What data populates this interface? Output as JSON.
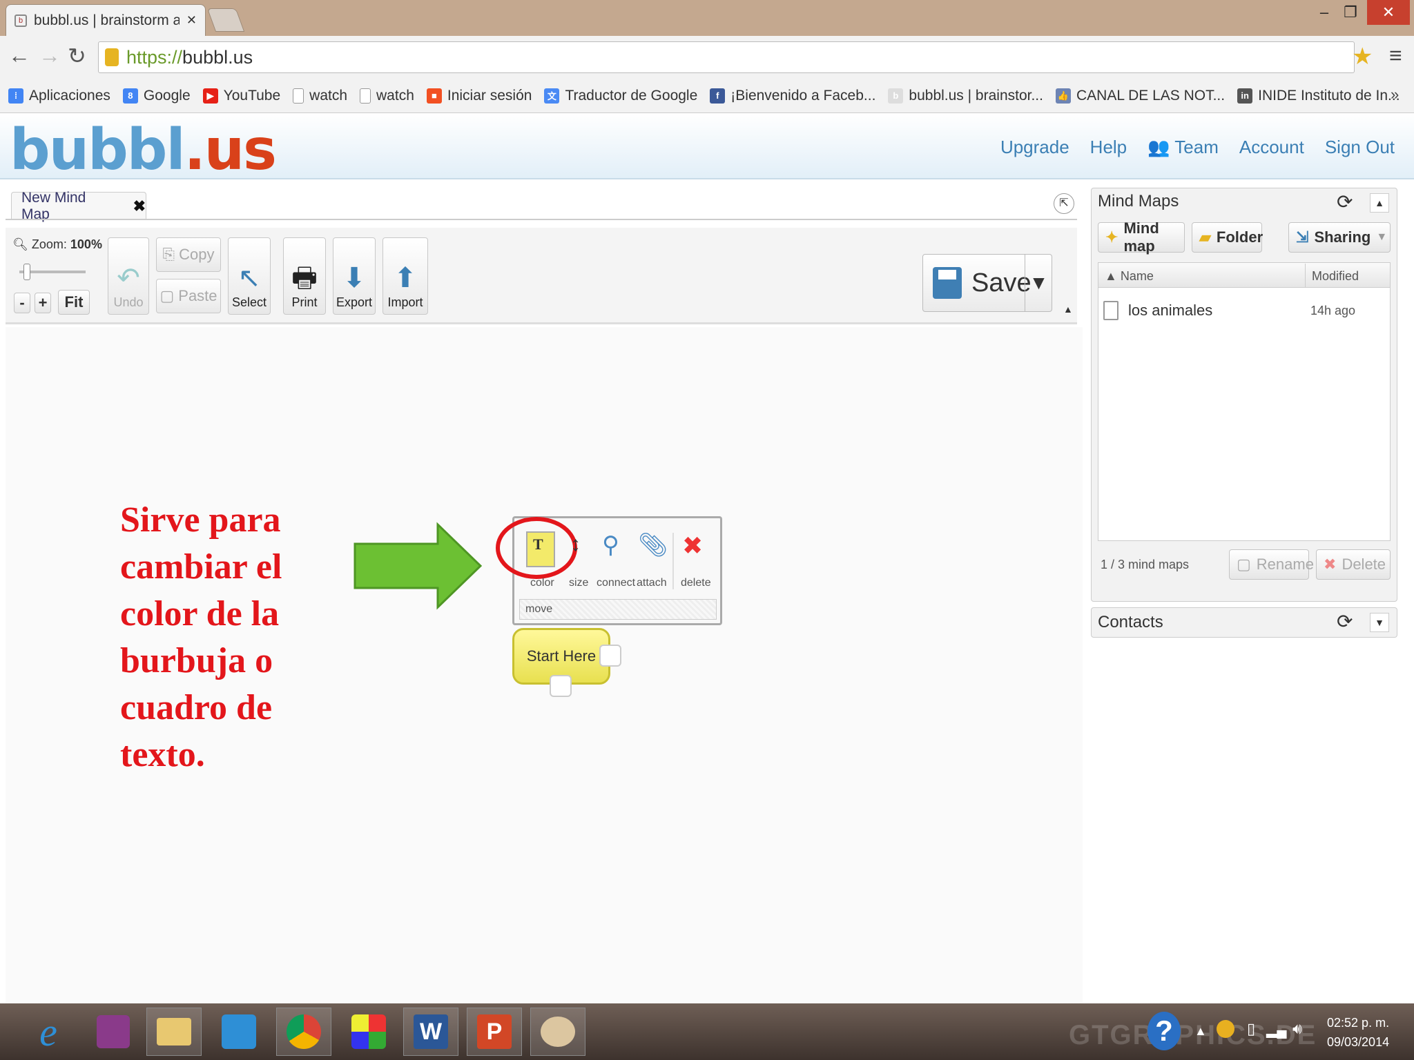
{
  "browser": {
    "tab_title": "bubbl.us | brainstorm and",
    "url_scheme": "https://",
    "url_host": "bubbl.us",
    "window_controls": {
      "minimize": "–",
      "restore": "❐",
      "close": "✕"
    },
    "bookmarks": [
      {
        "label": "Aplicaciones",
        "icon": "apps-icon"
      },
      {
        "label": "Google",
        "icon": "google-icon"
      },
      {
        "label": "YouTube",
        "icon": "youtube-icon"
      },
      {
        "label": "watch",
        "icon": "page-icon"
      },
      {
        "label": "watch",
        "icon": "page-icon"
      },
      {
        "label": "Iniciar sesión",
        "icon": "microsoft-icon"
      },
      {
        "label": "Traductor de Google",
        "icon": "translate-icon"
      },
      {
        "label": "¡Bienvenido a Faceb...",
        "icon": "facebook-icon"
      },
      {
        "label": "bubbl.us | brainstor...",
        "icon": "bubbl-icon"
      },
      {
        "label": "CANAL DE LAS NOT...",
        "icon": "thumb-icon"
      },
      {
        "label": "INIDE Instituto de In...",
        "icon": "inide-icon"
      }
    ],
    "bookmarks_overflow": "»"
  },
  "app": {
    "logo_b": "bubbl",
    "logo_dot": ".",
    "logo_us": "us",
    "nav": {
      "upgrade": "Upgrade",
      "help": "Help",
      "team": "Team",
      "account": "Account",
      "signout": "Sign Out"
    }
  },
  "editor": {
    "doc_tab": "New Mind Map",
    "zoom_label": "Zoom:",
    "zoom_value": "100%",
    "zoom_minus": "-",
    "zoom_plus": "+",
    "zoom_fit": "Fit",
    "toolbar": {
      "undo": "Undo",
      "copy": "Copy",
      "paste": "Paste",
      "select": "Select",
      "print": "Print",
      "export": "Export",
      "import": "Import",
      "save": "Save"
    }
  },
  "canvas": {
    "annotation": [
      "Sirve para",
      "cambiar el",
      "color de la",
      "burbuja o",
      "cuadro de",
      "texto."
    ],
    "popup": {
      "color": "color",
      "size": "size",
      "connect": "connect",
      "attach": "attach",
      "delete": "delete",
      "move": "move",
      "color_glyph": "T"
    },
    "bubble_text": "Start Here"
  },
  "sidebar": {
    "mindmaps_title": "Mind Maps",
    "buttons": {
      "mindmap": "Mind map",
      "folder": "Folder",
      "sharing": "Sharing"
    },
    "columns": {
      "name": "Name",
      "modified": "Modified"
    },
    "files": [
      {
        "name": "los animales",
        "modified": "14h ago"
      }
    ],
    "count": "1 / 3 mind maps",
    "rename": "Rename",
    "delete": "Delete",
    "contacts_title": "Contacts"
  },
  "taskbar": {
    "time": "02:52 p. m.",
    "date": "09/03/2014",
    "watermark": "GTGRAPHICS.DE"
  },
  "colors": {
    "accent_link": "#3b7fb4",
    "annotation_red": "#e3161b",
    "arrow_green": "#6cc033",
    "bubble_yellow": "#f3ea6a"
  }
}
